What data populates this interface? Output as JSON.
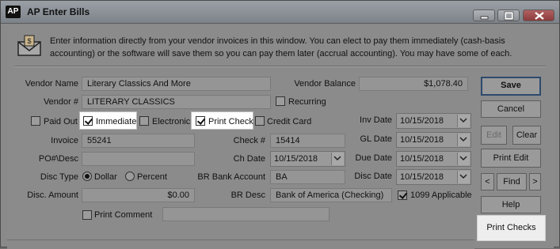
{
  "window": {
    "title": "AP Enter Bills",
    "app_icon_text": "AP",
    "controls": [
      "minimize-icon",
      "maximize-icon",
      "close-icon"
    ]
  },
  "intro": {
    "icon": "envelope-bill-icon",
    "text": "Enter information directly from your vendor invoices in this window. You can elect to pay them immediately (cash-basis accounting) or the software will save them so you can pay them later (accrual accounting). You may have some of each."
  },
  "form": {
    "vendor_name_label": "Vendor Name",
    "vendor_name": "Literary Classics And More",
    "vendor_num_label": "Vendor #",
    "vendor_num": "LITERARY CLASSICS",
    "vendor_balance_label": "Vendor Balance",
    "vendor_balance": "$1,078.40",
    "recurring_label": "Recurring",
    "paid_out_label": "Paid Out",
    "immediate_label": "Immediate",
    "electronic_label": "Electronic",
    "print_check_label": "Print Check",
    "credit_card_label": "Credit Card",
    "invoice_label": "Invoice",
    "invoice": "55241",
    "po_desc_label": "PO#\\Desc",
    "po_desc": "",
    "disc_type_label": "Disc Type",
    "dollar_label": "Dollar",
    "percent_label": "Percent",
    "disc_amount_label": "Disc. Amount",
    "disc_amount": "$0.00",
    "print_comment_label": "Print Comment",
    "print_comment": "",
    "check_num_label": "Check #",
    "check_num": "15414",
    "ch_date_label": "Ch Date",
    "ch_date": "10/15/2018",
    "br_bank_account_label": "BR Bank Account",
    "br_bank_account": "BA",
    "br_desc_label": "BR Desc",
    "br_desc": "Bank of America (Checking)",
    "inv_date_label": "Inv Date",
    "inv_date": "10/15/2018",
    "gl_date_label": "GL Date",
    "gl_date": "10/15/2018",
    "due_date_label": "Due Date",
    "due_date": "10/15/2018",
    "disc_date_label": "Disc Date",
    "disc_date": "10/15/2018",
    "applicable_1099_label": "1099 Applicable",
    "checks": {
      "recurring": false,
      "paid_out": false,
      "immediate": true,
      "electronic": false,
      "print_check": true,
      "credit_card": false,
      "print_comment": false,
      "applicable_1099": true
    },
    "disc_type_selected": "Dollar"
  },
  "buttons": {
    "save": "Save",
    "cancel": "Cancel",
    "edit": "Edit",
    "clear": "Clear",
    "print_edit": "Print Edit",
    "prev": "<",
    "find": "Find",
    "next": ">",
    "help": "Help",
    "print_checks": "Print Checks"
  },
  "colors": {
    "highlight": "#ffffff",
    "default_button_border": "#2d4a6e"
  }
}
